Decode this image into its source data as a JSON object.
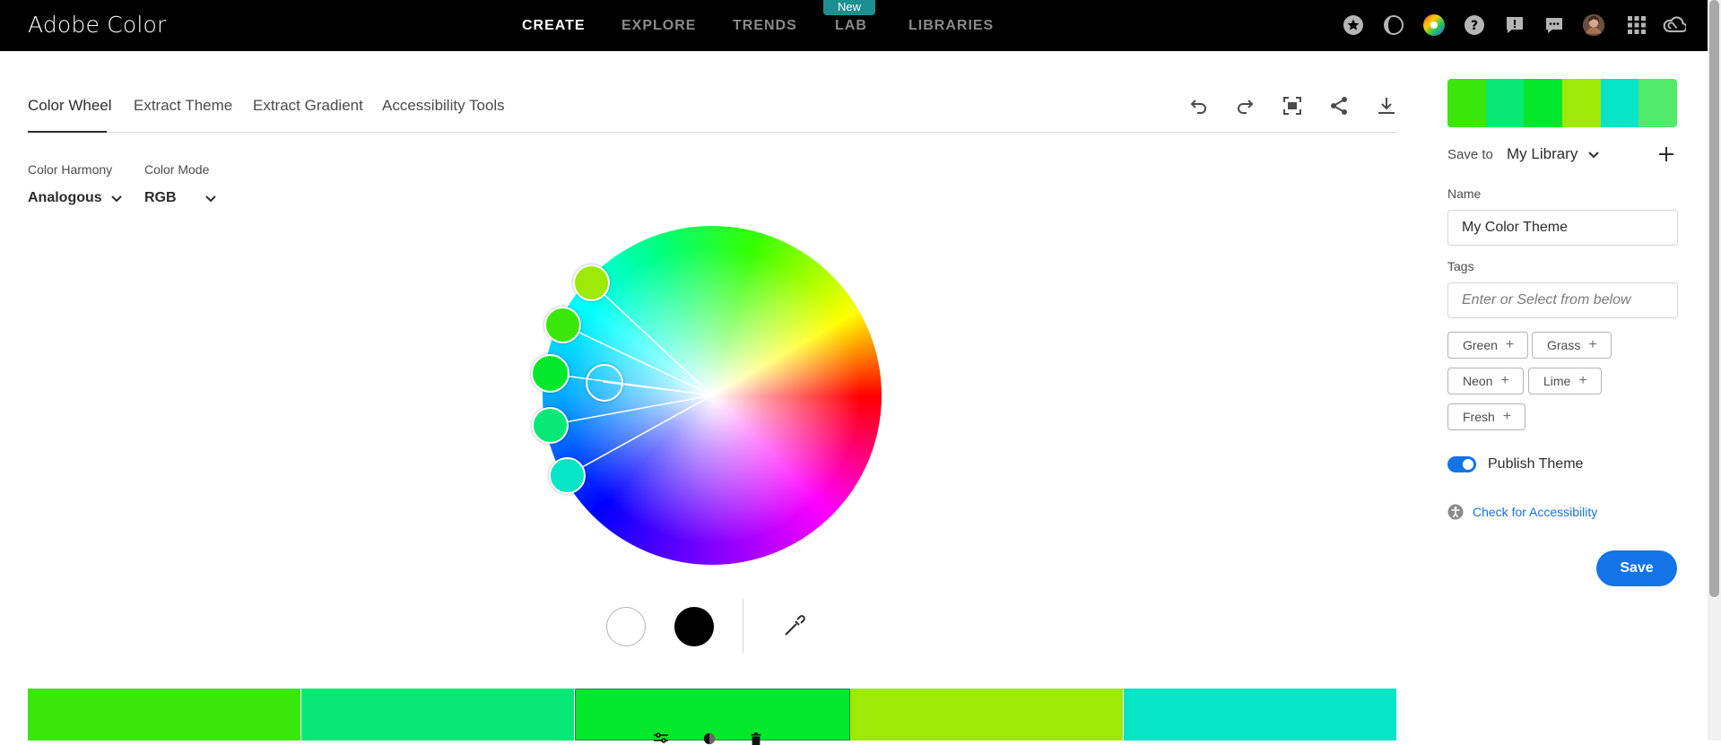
{
  "topbar": {
    "brand": "Adobe Color",
    "nav": [
      {
        "label": "CREATE",
        "active": true
      },
      {
        "label": "EXPLORE",
        "active": false
      },
      {
        "label": "TRENDS",
        "active": false
      },
      {
        "label": "LAB",
        "active": false
      },
      {
        "label": "LIBRARIES",
        "active": false
      }
    ],
    "new_badge": "New",
    "icons": [
      "star-icon",
      "contrast-icon",
      "color-wheel-icon",
      "help-icon",
      "feedback-icon",
      "chat-icon",
      "avatar",
      "apps-grid-icon",
      "creative-cloud-icon"
    ]
  },
  "tabs": {
    "items": [
      "Color Wheel",
      "Extract Theme",
      "Extract Gradient",
      "Accessibility Tools"
    ],
    "active": "Color Wheel"
  },
  "toolbar": {
    "icons": [
      "undo-icon",
      "redo-icon",
      "fit-screen-icon",
      "share-icon",
      "download-icon"
    ]
  },
  "controls": {
    "harmony_label": "Color Harmony",
    "harmony_value": "Analogous",
    "mode_label": "Color Mode",
    "mode_value": "RGB"
  },
  "swatch_controls": {
    "white": "#ffffff",
    "black": "#000000",
    "icons": [
      "eyedropper-icon"
    ]
  },
  "theme": {
    "colors": [
      "#39e80a",
      "#07e874",
      "#04e82c",
      "#9de907",
      "#06e5c5"
    ],
    "selected_index": 2,
    "preview_colors": [
      "#39e80a",
      "#07e874",
      "#04e82c",
      "#9de907",
      "#06e5c5",
      "#52ea6a"
    ],
    "tool_icons": [
      "sliders-icon",
      "contrast-icon",
      "trash-icon"
    ]
  },
  "sidebar": {
    "save_to_label": "Save to",
    "library_value": "My Library",
    "name_label": "Name",
    "name_value": "My Color Theme",
    "tags_label": "Tags",
    "tags_placeholder": "Enter or Select from below",
    "tags": [
      "Green",
      "Grass",
      "Neon",
      "Lime",
      "Fresh"
    ],
    "publish_label": "Publish Theme",
    "publish_on": true,
    "accessibility_link": "Check for Accessibility",
    "save_button": "Save"
  }
}
